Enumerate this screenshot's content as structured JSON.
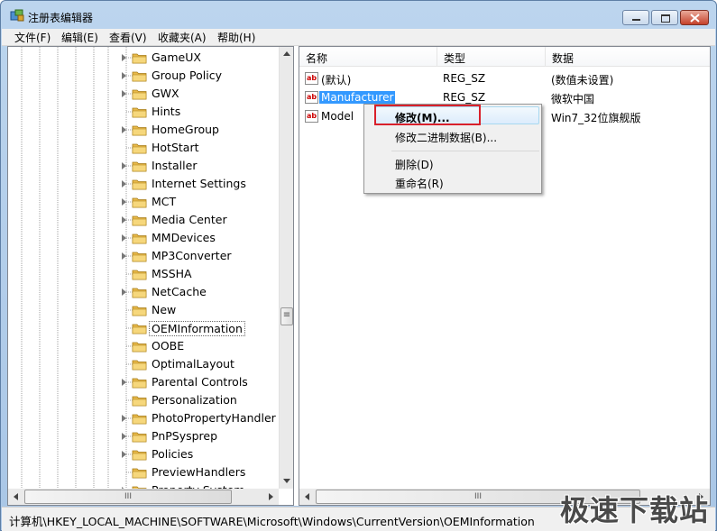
{
  "window": {
    "title": "注册表编辑器"
  },
  "menu": [
    "文件(F)",
    "编辑(E)",
    "查看(V)",
    "收藏夹(A)",
    "帮助(H)"
  ],
  "tree": {
    "items": [
      {
        "label": "GameUX",
        "expandable": true
      },
      {
        "label": "Group Policy",
        "expandable": true
      },
      {
        "label": "GWX",
        "expandable": true
      },
      {
        "label": "Hints",
        "expandable": false
      },
      {
        "label": "HomeGroup",
        "expandable": true
      },
      {
        "label": "HotStart",
        "expandable": false
      },
      {
        "label": "Installer",
        "expandable": true
      },
      {
        "label": "Internet Settings",
        "expandable": true
      },
      {
        "label": "MCT",
        "expandable": true
      },
      {
        "label": "Media Center",
        "expandable": true
      },
      {
        "label": "MMDevices",
        "expandable": true
      },
      {
        "label": "MP3Converter",
        "expandable": true
      },
      {
        "label": "MSSHA",
        "expandable": false
      },
      {
        "label": "NetCache",
        "expandable": true
      },
      {
        "label": "New",
        "expandable": false
      },
      {
        "label": "OEMInformation",
        "expandable": false,
        "selected": true
      },
      {
        "label": "OOBE",
        "expandable": false
      },
      {
        "label": "OptimalLayout",
        "expandable": false
      },
      {
        "label": "Parental Controls",
        "expandable": true
      },
      {
        "label": "Personalization",
        "expandable": false
      },
      {
        "label": "PhotoPropertyHandler",
        "expandable": true
      },
      {
        "label": "PnPSysprep",
        "expandable": true
      },
      {
        "label": "Policies",
        "expandable": true
      },
      {
        "label": "PreviewHandlers",
        "expandable": false
      },
      {
        "label": "Property System",
        "expandable": true
      }
    ]
  },
  "values": {
    "columns": [
      "名称",
      "类型",
      "数据"
    ],
    "rows": [
      {
        "name": "(默认)",
        "type": "REG_SZ",
        "data": "(数值未设置)"
      },
      {
        "name": "Manufacturer",
        "type": "REG_SZ",
        "data": "微软中国",
        "selected": true
      },
      {
        "name": "Model",
        "type": "",
        "data": "Win7_32位旗舰版"
      }
    ]
  },
  "context_menu": {
    "items": [
      "修改(M)...",
      "修改二进制数据(B)...",
      "删除(D)",
      "重命名(R)"
    ]
  },
  "scroll": {
    "h_thumb_glyph": "III",
    "v_thumb_glyph": "≡"
  },
  "status": {
    "path": "计算机\\HKEY_LOCAL_MACHINE\\SOFTWARE\\Microsoft\\Windows\\CurrentVersion\\OEMInformation"
  },
  "watermark": {
    "text": "极速下载站"
  },
  "colors": {
    "selection": "#3399ff",
    "highlight_box": "#d9202a",
    "folder": "#e8b94a"
  }
}
